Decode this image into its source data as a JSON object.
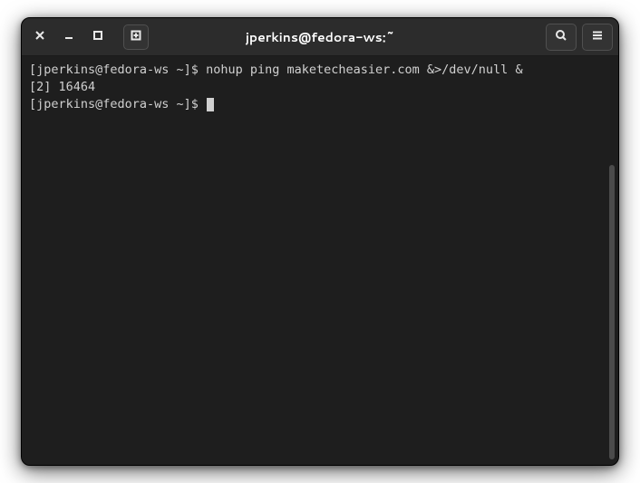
{
  "titlebar": {
    "title": "jperkins@fedora-ws:~"
  },
  "terminal": {
    "lines": [
      {
        "prompt": "[jperkins@fedora-ws ~]$ ",
        "command": "nohup ping maketecheasier.com &>/dev/null &"
      },
      {
        "output": "[2] 16464"
      },
      {
        "prompt": "[jperkins@fedora-ws ~]$ ",
        "cursor": true
      }
    ]
  }
}
